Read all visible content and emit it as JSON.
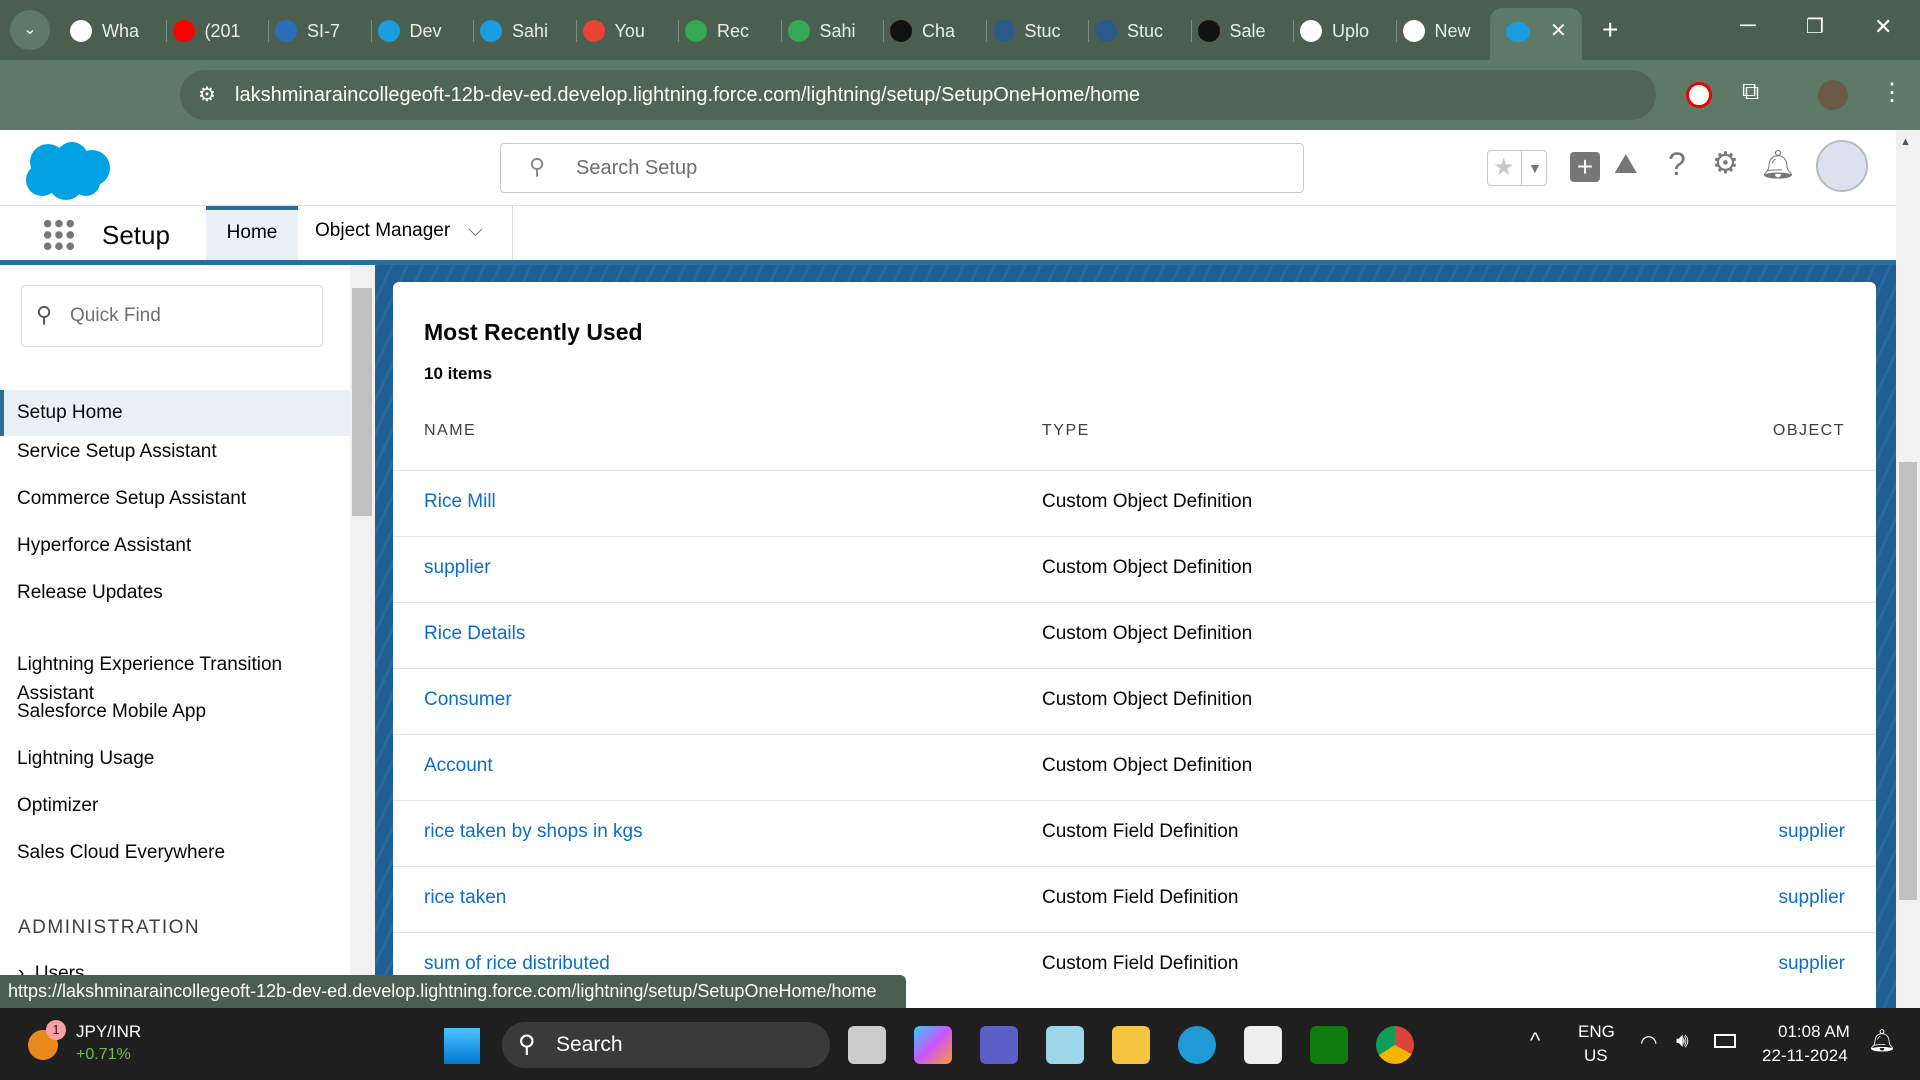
{
  "browser": {
    "tabs": [
      "Wha",
      "(201",
      "SI-7",
      "Dev",
      "Sahi",
      "You",
      "Rec",
      "Sahi",
      "Cha",
      "Stuc",
      "Stuc",
      "Sale",
      "Uplo",
      "New"
    ],
    "url": "lakshminaraincollegeoft-12b-dev-ed.develop.lightning.force.com/lightning/setup/SetupOneHome/home",
    "status_url": "https://lakshminaraincollegeoft-12b-dev-ed.develop.lightning.force.com/lightning/setup/SetupOneHome/home"
  },
  "header": {
    "search_placeholder": "Search Setup"
  },
  "nav": {
    "app": "Setup",
    "tabs": [
      "Home",
      "Object Manager"
    ]
  },
  "sidebar": {
    "quick_find_placeholder": "Quick Find",
    "items": [
      "Setup Home",
      "Service Setup Assistant",
      "Commerce Setup Assistant",
      "Hyperforce Assistant",
      "Release Updates",
      "Lightning Experience Transition Assistant",
      "Salesforce Mobile App",
      "Lightning Usage",
      "Optimizer",
      "Sales Cloud Everywhere"
    ],
    "section": "ADMINISTRATION",
    "sub": "Users"
  },
  "card": {
    "title": "Most Recently Used",
    "count": "10 items",
    "columns": [
      "NAME",
      "TYPE",
      "OBJECT"
    ],
    "rows": [
      {
        "name": "Rice Mill",
        "type": "Custom Object Definition",
        "object": ""
      },
      {
        "name": "supplier",
        "type": "Custom Object Definition",
        "object": ""
      },
      {
        "name": "Rice Details",
        "type": "Custom Object Definition",
        "object": ""
      },
      {
        "name": "Consumer",
        "type": "Custom Object Definition",
        "object": ""
      },
      {
        "name": "Account",
        "type": "Custom Object Definition",
        "object": ""
      },
      {
        "name": "rice taken by shops in kgs",
        "type": "Custom Field Definition",
        "object": "supplier"
      },
      {
        "name": "rice taken",
        "type": "Custom Field Definition",
        "object": "supplier"
      },
      {
        "name": "sum of rice distributed",
        "type": "Custom Field Definition",
        "object": "supplier"
      }
    ]
  },
  "taskbar": {
    "widget_title": "JPY/INR",
    "widget_value": "+0.71%",
    "badge": "1",
    "search": "Search",
    "lang1": "ENG",
    "lang2": "US",
    "time": "01:08 AM",
    "date": "22-11-2024"
  }
}
